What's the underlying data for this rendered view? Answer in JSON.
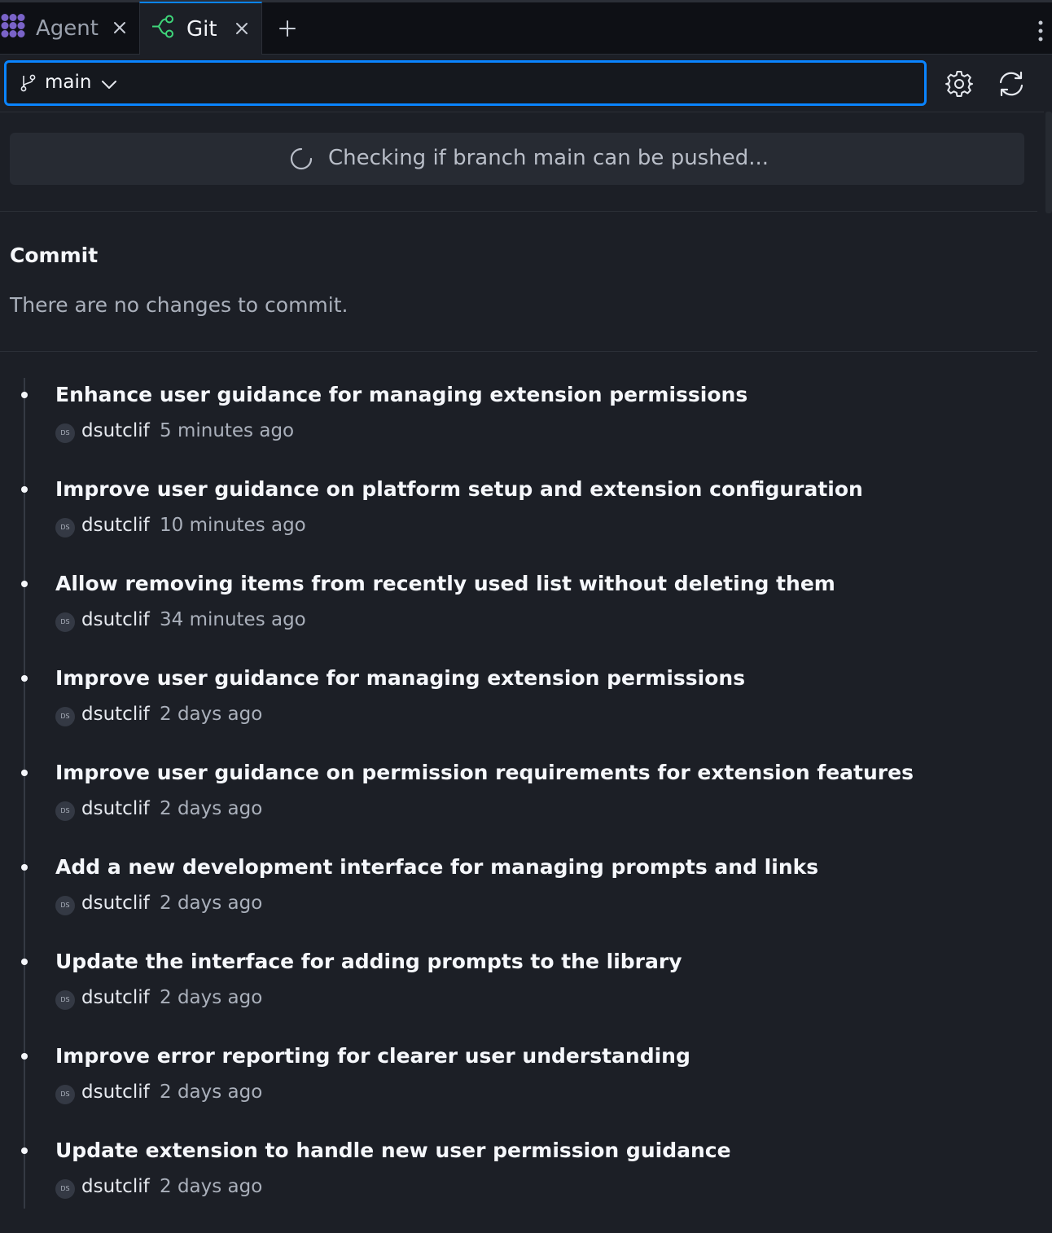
{
  "tabs": [
    {
      "label": "Agent",
      "icon": "agent-logo-icon",
      "active": false
    },
    {
      "label": "Git",
      "icon": "git-branch-icon",
      "active": true
    }
  ],
  "colors": {
    "accent": "#0a84ff",
    "git_icon": "#3fd67a",
    "agent_icon": "#7a63c8",
    "background": "#1c1f26"
  },
  "branch": {
    "name": "main"
  },
  "push_status": {
    "text": "Checking if branch main can be pushed..."
  },
  "commit": {
    "title": "Commit",
    "empty_message": "There are no changes to commit."
  },
  "history": [
    {
      "message": "Enhance user guidance for managing extension permissions",
      "avatar": "DS",
      "author": "dsutclif",
      "time": "5 minutes ago"
    },
    {
      "message": "Improve user guidance on platform setup and extension configuration",
      "avatar": "DS",
      "author": "dsutclif",
      "time": "10 minutes ago"
    },
    {
      "message": "Allow removing items from recently used list without deleting them",
      "avatar": "DS",
      "author": "dsutclif",
      "time": "34 minutes ago"
    },
    {
      "message": "Improve user guidance for managing extension permissions",
      "avatar": "DS",
      "author": "dsutclif",
      "time": "2 days ago"
    },
    {
      "message": "Improve user guidance on permission requirements for extension features",
      "avatar": "DS",
      "author": "dsutclif",
      "time": "2 days ago"
    },
    {
      "message": "Add a new development interface for managing prompts and links",
      "avatar": "DS",
      "author": "dsutclif",
      "time": "2 days ago"
    },
    {
      "message": "Update the interface for adding prompts to the library",
      "avatar": "DS",
      "author": "dsutclif",
      "time": "2 days ago"
    },
    {
      "message": "Improve error reporting for clearer user understanding",
      "avatar": "DS",
      "author": "dsutclif",
      "time": "2 days ago"
    },
    {
      "message": "Update extension to handle new user permission guidance",
      "avatar": "DS",
      "author": "dsutclif",
      "time": "2 days ago"
    }
  ]
}
